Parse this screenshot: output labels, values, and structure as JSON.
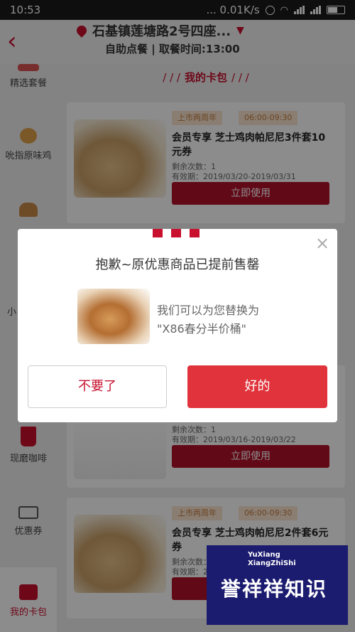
{
  "status_bar": {
    "time": "10:53",
    "speed": "... 0.01K/s"
  },
  "header": {
    "back_icon": "chevron-left-icon",
    "address": "石基镇莲塘路2号四座...",
    "subtitle": "自助点餐 | 取餐时间:13:00",
    "accent_color": "#c8102e"
  },
  "sidebar": {
    "items": [
      {
        "label": "精选套餐"
      },
      {
        "label": "吮指原味鸡"
      },
      {
        "label": "小"
      },
      {
        "label": "现磨咖啡"
      },
      {
        "label": "优惠券"
      },
      {
        "label": "我的卡包"
      }
    ]
  },
  "content": {
    "section_title": "我的卡包",
    "cards": [
      {
        "tag_1": "上市两周年",
        "tag_2": "06:00-09:30",
        "title": "会员专享 芝士鸡肉帕尼尼3件套10元券",
        "remaining": "剩余次数：1",
        "valid": "有效期：2019/03/20-2019/03/31",
        "button": "立即使用"
      },
      {
        "remaining": "剩余次数：1",
        "valid": "有效期：2019/03/16-2019/03/22",
        "button": "立即使用"
      },
      {
        "tag_1": "上市两周年",
        "tag_2": "06:00-09:30",
        "title": "会员专享 芝士鸡肉帕尼尼2件套6元券",
        "remaining": "剩余次数：1",
        "valid": "有效期：2",
        "button": "立即使用"
      }
    ]
  },
  "dialog": {
    "title": "抱歉~原优惠商品已提前售罄",
    "message_line1": "我们可以为您替换为",
    "message_line2": "\"X86春分半价桶\"",
    "cancel_label": "不要了",
    "confirm_label": "好的",
    "confirm_color": "#e0333c"
  },
  "watermark": {
    "pinyin_1": "YuXiang",
    "pinyin_2": "XiangZhiShi",
    "text": "誉祥祥知识"
  }
}
